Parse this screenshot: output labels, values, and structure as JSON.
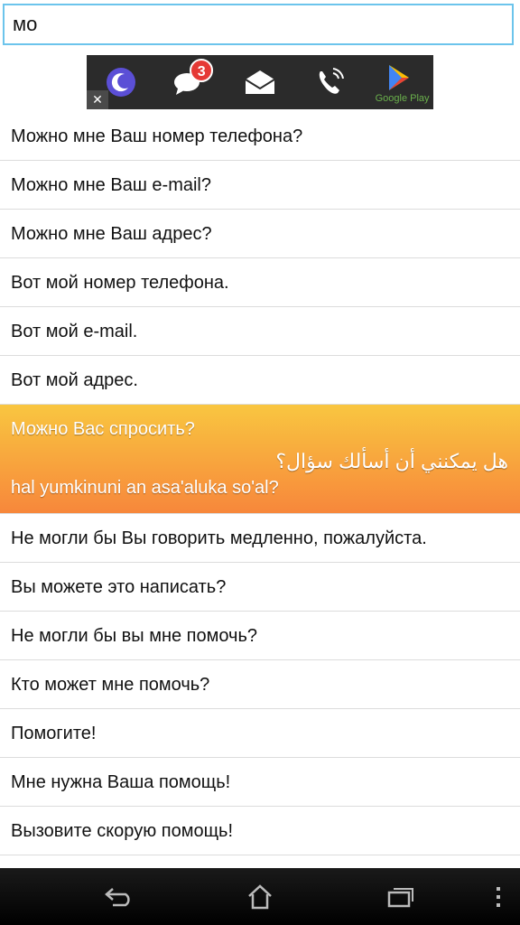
{
  "search": {
    "value": "мо",
    "placeholder": ""
  },
  "ad": {
    "close_label": "✕",
    "icons": [
      "moon-app-icon",
      "chat-icon",
      "mail-icon",
      "phone-icon",
      "google-play-icon"
    ],
    "chat_badge": "3",
    "google_play_label": "Google Play"
  },
  "phrases": [
    {
      "ru": "Можно мне Ваш номер телефона?"
    },
    {
      "ru": "Можно мне Ваш e-mail?"
    },
    {
      "ru": "Можно мне Ваш адрес?"
    },
    {
      "ru": "Вот мой номер телефона."
    },
    {
      "ru": "Вот мой e-mail."
    },
    {
      "ru": "Вот мой адрес."
    },
    {
      "ru": "Можно Вас спросить?",
      "ar": "هل يمكنني أن أسألك سؤال؟",
      "translit": "hal yumkinuni an asa'aluka so'al?",
      "selected": true
    },
    {
      "ru": "Не могли бы Вы говорить медленно, пожалуйста."
    },
    {
      "ru": "Вы можете это написать?"
    },
    {
      "ru": "Не могли бы вы мне помочь?"
    },
    {
      "ru": "Кто может мне помочь?"
    },
    {
      "ru": "Помогите!"
    },
    {
      "ru": "Мне нужна Ваша помощь!"
    },
    {
      "ru": "Вызовите скорую помощь!"
    }
  ],
  "navbar": {
    "icons": [
      "back-icon",
      "home-icon",
      "recent-apps-icon",
      "overflow-menu-icon"
    ]
  },
  "colors": {
    "selected_top": "#f9c640",
    "selected_bottom": "#f7873b",
    "search_border": "#6cc4ec"
  }
}
